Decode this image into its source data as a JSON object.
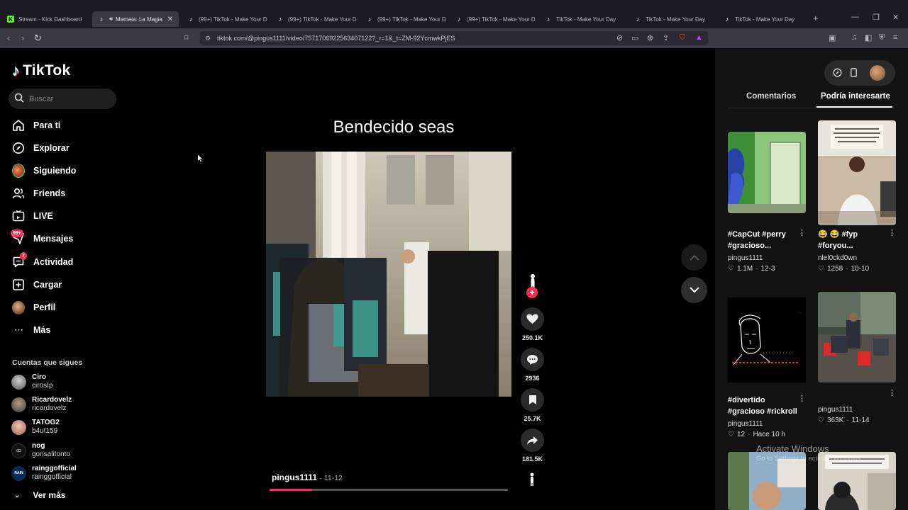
{
  "browser": {
    "tabs": [
      {
        "title": "Stream - Kick Dashboard",
        "favicon": "kick-icon",
        "active": false
      },
      {
        "title": "Memeia: La Magia",
        "favicon": "tiktok-icon",
        "active": true
      },
      {
        "title": "(99+) TikTok - Make Your D",
        "favicon": "tiktok-icon",
        "active": false
      },
      {
        "title": "(99+) TikTok - Make Your D",
        "favicon": "tiktok-icon",
        "active": false
      },
      {
        "title": "(99+) TikTok - Make Your D",
        "favicon": "tiktok-icon",
        "active": false
      },
      {
        "title": "(99+) TikTok - Make Your D",
        "favicon": "tiktok-icon",
        "active": false
      },
      {
        "title": "TikTok - Make Your Day",
        "favicon": "tiktok-icon",
        "active": false
      },
      {
        "title": "TikTok - Make Your Day",
        "favicon": "tiktok-icon",
        "active": false
      },
      {
        "title": "TikTok - Make Your Day",
        "favicon": "tiktok-icon",
        "active": false
      }
    ],
    "url": "tiktok.com/@pingus1111/video/7571706922563407122?_r=1&_t=ZM-92YcmwkPjES"
  },
  "sidebar": {
    "logo": "TikTok",
    "search_placeholder": "Buscar",
    "nav": [
      {
        "label": "Para ti",
        "icon": "home-icon"
      },
      {
        "label": "Explorar",
        "icon": "compass-icon"
      },
      {
        "label": "Siguiendo",
        "icon": "following-avatar-icon"
      },
      {
        "label": "Friends",
        "icon": "friends-icon"
      },
      {
        "label": "LIVE",
        "icon": "live-icon"
      },
      {
        "label": "Mensajes",
        "icon": "messages-icon",
        "badge": "99+"
      },
      {
        "label": "Actividad",
        "icon": "activity-icon",
        "badge": "7"
      },
      {
        "label": "Cargar",
        "icon": "upload-icon"
      },
      {
        "label": "Perfil",
        "icon": "profile-avatar-icon"
      },
      {
        "label": "Más",
        "icon": "more-icon"
      }
    ],
    "following_title": "Cuentas que sigues",
    "accounts": [
      {
        "name": "Ciro",
        "handle": "cirosIp"
      },
      {
        "name": "Ricardovelz",
        "handle": "ricardovelz"
      },
      {
        "name": "TATOG2",
        "handle": "b4ut159"
      },
      {
        "name": "nog",
        "handle": "gonsalitonto"
      },
      {
        "name": "rainggofficial",
        "handle": "rainggofficial"
      }
    ],
    "see_more": "Ver más"
  },
  "video": {
    "title": "Bendecido seas",
    "author": "pingus1111",
    "date": "· 11-12",
    "progress": 0.18,
    "likes": "250.1K",
    "comments": "2936",
    "saves": "25.7K",
    "shares": "181.5K"
  },
  "right_panel": {
    "tabs": [
      "Comentarios",
      "Podría interesarte"
    ],
    "active_tab": "Podría interesarte",
    "cards": [
      {
        "title": "#CapCut #perry #gracioso...",
        "user": "pingus1111",
        "likes": "1.1M",
        "date": "12-3"
      },
      {
        "title": "😂 😂 #fyp #foryou...",
        "user": "nlel0ckd0wn",
        "likes": "1258",
        "date": "10-10"
      },
      {
        "title": "#divertido #gracioso #rickroll",
        "user": "pingus1111",
        "likes": "12",
        "date": "Hace 10 h"
      },
      {
        "title": "",
        "user": "pingus1111",
        "likes": "363K",
        "date": "11-14"
      }
    ]
  },
  "windows_watermark": {
    "line1": "Activate Windows",
    "line2": "Go to Settings to activate Windows."
  },
  "colors": {
    "accent": "#fe2c55",
    "background": "#000000",
    "panel": "#121212"
  }
}
